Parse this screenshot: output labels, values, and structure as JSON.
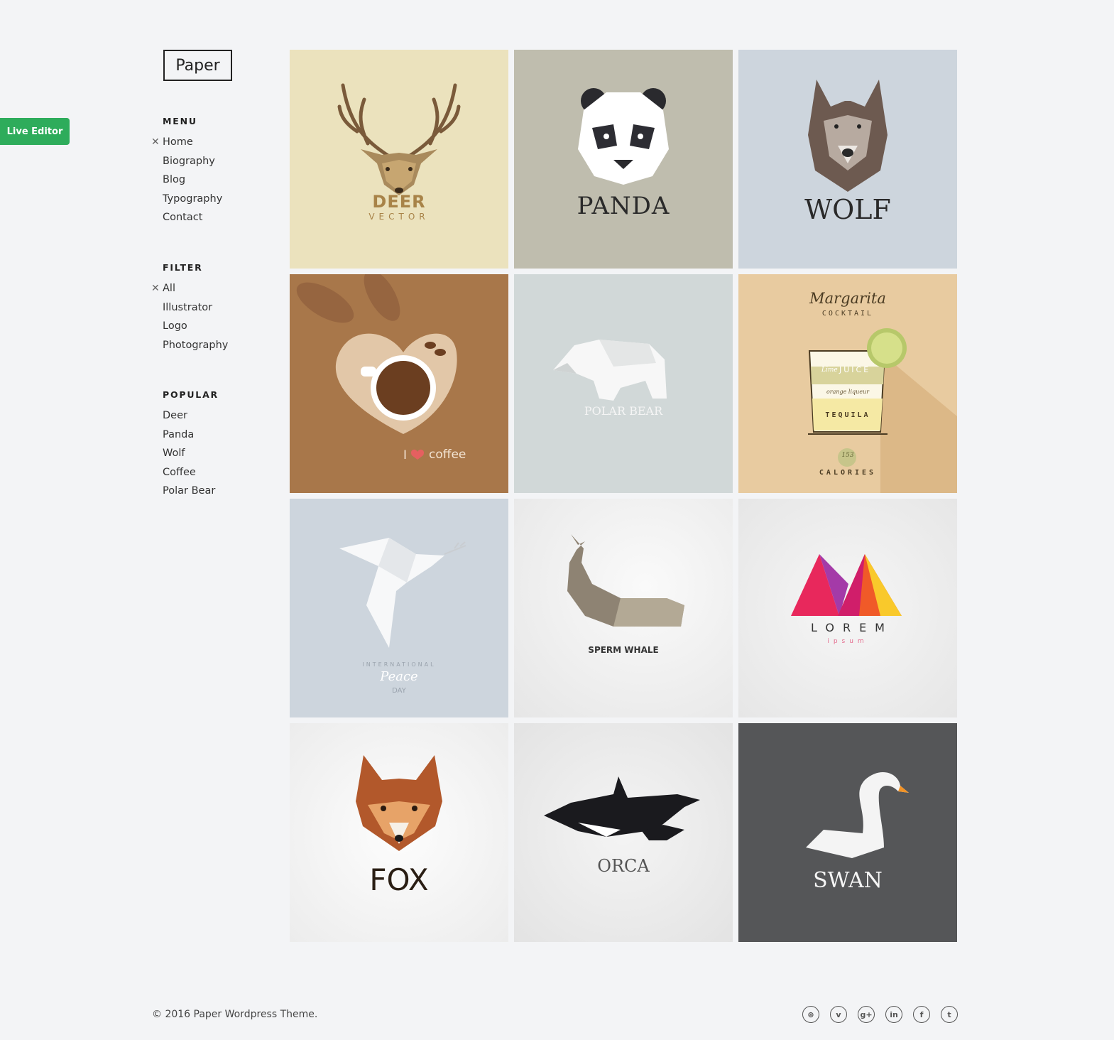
{
  "live_editor": {
    "label": "Live Editor"
  },
  "site": {
    "logo": "Paper"
  },
  "menu": {
    "heading": "MENU",
    "items": [
      {
        "label": "Home",
        "active": true
      },
      {
        "label": "Biography"
      },
      {
        "label": "Blog"
      },
      {
        "label": "Typography"
      },
      {
        "label": "Contact"
      }
    ]
  },
  "filter": {
    "heading": "FILTER",
    "items": [
      {
        "label": "All",
        "active": true
      },
      {
        "label": "Illustrator"
      },
      {
        "label": "Logo"
      },
      {
        "label": "Photography"
      }
    ]
  },
  "popular": {
    "heading": "POPULAR",
    "items": [
      {
        "label": "Deer"
      },
      {
        "label": "Panda"
      },
      {
        "label": "Wolf"
      },
      {
        "label": "Coffee"
      },
      {
        "label": "Polar Bear"
      }
    ]
  },
  "gallery": {
    "deer": {
      "title": "DEER",
      "subtitle": "VECTOR",
      "bg": "#ebe2bd"
    },
    "panda": {
      "title": "PANDA",
      "bg": "#bfbdae"
    },
    "wolf": {
      "title": "WOLF",
      "bg": "#cdd5dd"
    },
    "coffee": {
      "prefix": "I",
      "title": "coffee",
      "bg": "#a8774a"
    },
    "polar_bear": {
      "title": "POLAR BEAR",
      "bg": "#d1d8d8"
    },
    "margarita": {
      "title": "Margarita",
      "subtitle": "COCKTAIL",
      "layer1": "JUICE",
      "layer1_prefix": "Lime",
      "layer2": "orange liqueur",
      "layer3": "TEQUILA",
      "calories_value": "153",
      "calories_label": "CALORIES",
      "bg": "#e8cba0"
    },
    "peace": {
      "line1": "INTERNATIONAL",
      "line2": "Peace",
      "line3": "DAY",
      "bg": "#cdd5dd"
    },
    "whale": {
      "title": "SPERM WHALE",
      "bg": "#eeeeee"
    },
    "lorem": {
      "title": "LOREM",
      "subtitle": "ipsum",
      "bg": "#ededed"
    },
    "fox": {
      "title": "FOX",
      "bg": "#f1f1f1"
    },
    "orca": {
      "title": "ORCA",
      "bg": "#eaeaea"
    },
    "swan": {
      "title": "SWAN",
      "bg": "#555658"
    }
  },
  "footer": {
    "copyright": "© 2016 Paper Wordpress Theme.",
    "social": [
      {
        "icon": "dribbble-icon",
        "glyph": "⊛"
      },
      {
        "icon": "vimeo-icon",
        "glyph": "v"
      },
      {
        "icon": "google-plus-icon",
        "glyph": "g+"
      },
      {
        "icon": "linkedin-icon",
        "glyph": "in"
      },
      {
        "icon": "facebook-icon",
        "glyph": "f"
      },
      {
        "icon": "twitter-icon",
        "glyph": "t"
      }
    ]
  }
}
